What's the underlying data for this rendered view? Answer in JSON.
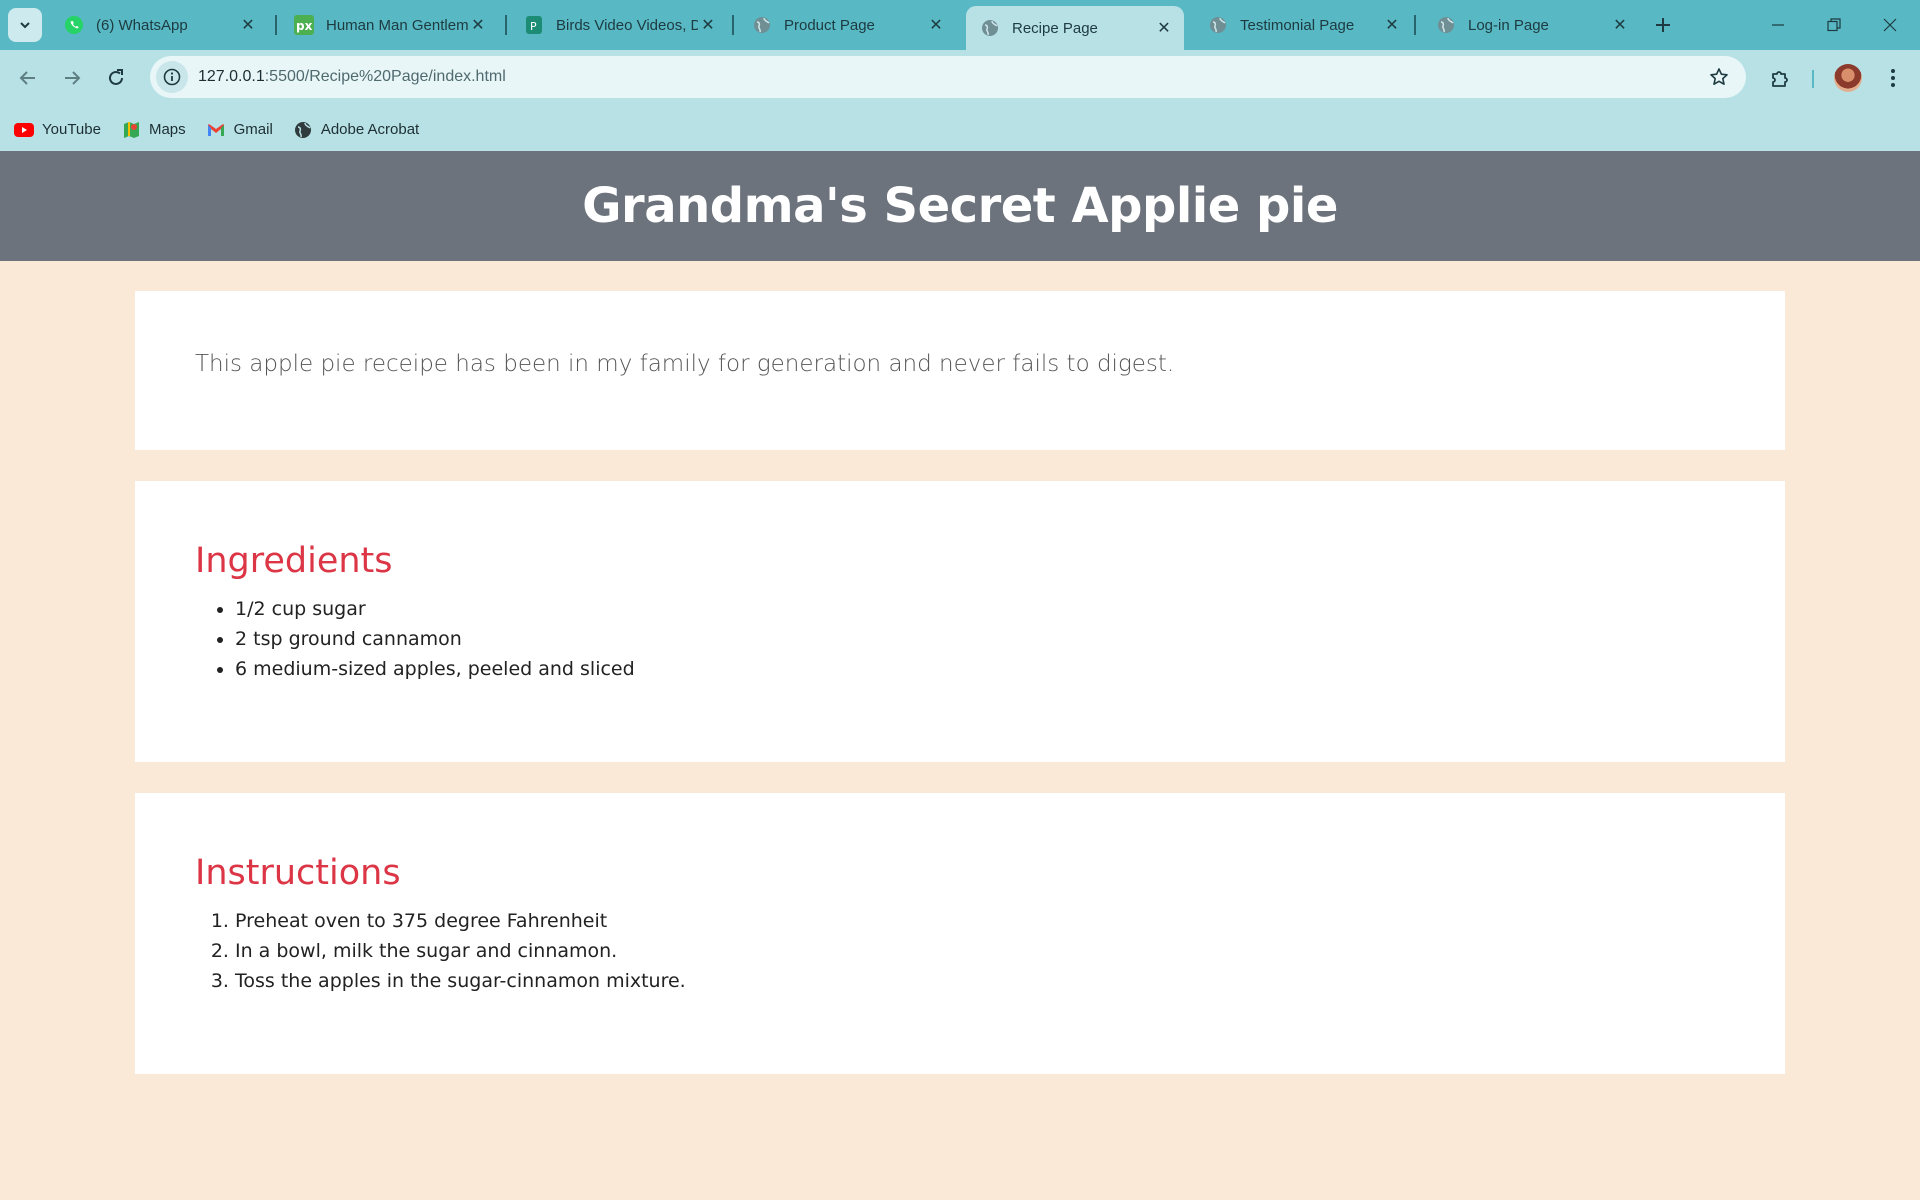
{
  "browser": {
    "tabs": [
      {
        "title": "(6) WhatsApp",
        "icon": "whatsapp-icon",
        "active": false
      },
      {
        "title": "Human Man Gentlem",
        "icon": "pixabay-icon",
        "active": false
      },
      {
        "title": "Birds Video Videos, D",
        "icon": "pexels-icon",
        "active": false
      },
      {
        "title": "Product Page",
        "icon": "globe-icon",
        "active": false
      },
      {
        "title": "Recipe Page",
        "icon": "globe-icon",
        "active": true
      },
      {
        "title": "Testimonial Page",
        "icon": "globe-icon",
        "active": false
      },
      {
        "title": "Log-in Page",
        "icon": "globe-icon",
        "active": false
      }
    ],
    "address": {
      "host": "127.0.0.1",
      "path": ":5500/Recipe%20Page/index.html"
    },
    "bookmarks": [
      {
        "label": "YouTube",
        "icon": "youtube-icon"
      },
      {
        "label": "Maps",
        "icon": "maps-icon"
      },
      {
        "label": "Gmail",
        "icon": "gmail-icon"
      },
      {
        "label": "Adobe Acrobat",
        "icon": "globe-icon"
      }
    ],
    "colors": {
      "tabbar": "#58b8c4",
      "toolbar": "#b8e1e6"
    }
  },
  "page": {
    "title": "Grandma's Secret Applie pie",
    "intro": "This apple pie receipe has been in my family for generation and never fails to digest.",
    "ingredients": {
      "heading": "Ingredients",
      "items": [
        "1/2 cup sugar",
        "2 tsp ground cannamon",
        "6 medium-sized apples, peeled and sliced"
      ]
    },
    "instructions": {
      "heading": "Instructions",
      "steps": [
        "Preheat oven to 375 degree Fahrenheit",
        "In a bowl, milk the sugar and cinnamon.",
        "Toss the apples in the sugar-cinnamon mixture."
      ]
    },
    "colors": {
      "background": "#fae9d7",
      "header": "#6c737c",
      "heading_accent": "#dc3545"
    }
  }
}
